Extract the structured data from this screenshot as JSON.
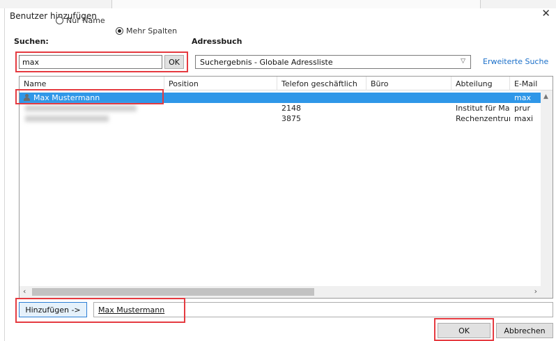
{
  "dialog": {
    "title": "Benutzer hinzufügen",
    "close_glyph": "✕"
  },
  "search": {
    "label": "Suchen:",
    "option_name_only": "Nur Name",
    "option_more_columns": "Mehr Spalten",
    "selected_option": "Mehr Spalten",
    "input_value": "max",
    "ok_label": "OK"
  },
  "addressbook": {
    "label": "Adressbuch",
    "selected": "Suchergebnis - Globale Adressliste",
    "advanced_search": "Erweiterte Suche"
  },
  "table": {
    "columns": [
      "Name",
      "Position",
      "Telefon geschäftlich",
      "Büro",
      "Abteilung",
      "E-Mail"
    ],
    "rows": [
      {
        "name": "Max Mustermann",
        "position": "",
        "phone": "",
        "office": "",
        "department": "",
        "email": "max",
        "selected": true
      },
      {
        "name": "",
        "position": "",
        "phone": "2148",
        "office": "",
        "department": "Institut für Masc...",
        "email": "prur",
        "selected": false
      },
      {
        "name": "",
        "position": "",
        "phone": "3875",
        "office": "",
        "department": "Rechenzentrum",
        "email": "maxi",
        "selected": false
      }
    ]
  },
  "bottom": {
    "add_button": "Hinzufügen ->",
    "added_value": "Max Mustermann",
    "ok_label": "OK",
    "cancel_label": "Abbrechen"
  },
  "colors": {
    "selection": "#2f97e8",
    "highlight": "#e53a40",
    "link": "#1a6fc9"
  },
  "icons": {
    "close": "close-icon",
    "dropdown": "chevron-down-icon",
    "contact": "person-icon"
  }
}
